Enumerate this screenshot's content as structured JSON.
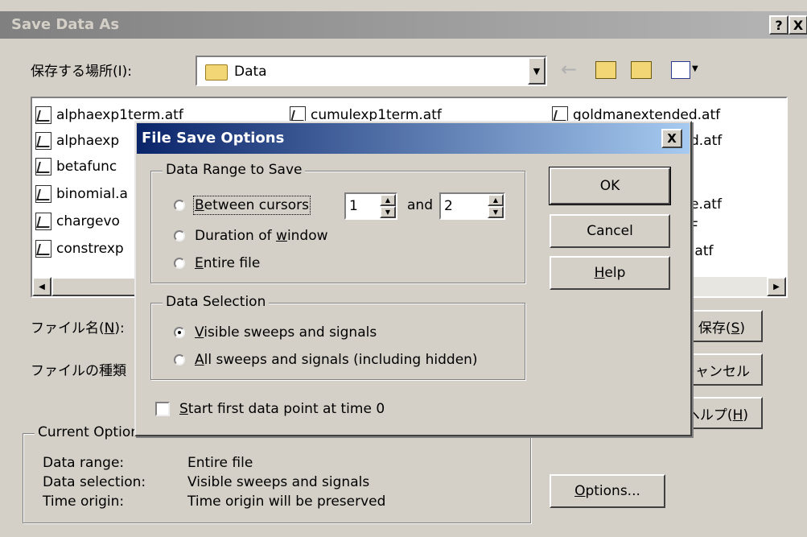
{
  "save_dialog": {
    "title": "Save Data As",
    "help_btn": "?",
    "close_btn": "X",
    "location_label": "保存する場所(I):",
    "location_value": "Data",
    "files": [
      "alphaexp1term.atf",
      "alphaexp",
      "betafunc",
      "binomial.a",
      "chargevo",
      "constrexp",
      "cumulexp1term.atf",
      "goldmanextended.atf",
      "d.atf",
      "e.atf",
      "F",
      ".atf"
    ],
    "filename_label_pre": "ファイル名(",
    "filename_label_key": "N",
    "filename_label_post": "):",
    "filetype_label": "ファイルの種類",
    "save_btn_pre": "保存(",
    "save_btn_key": "S",
    "save_btn_post": ")",
    "cancel_btn": "キャンセル",
    "help_btn_jp_pre": "ヘルプ(",
    "help_btn_jp_key": "H",
    "help_btn_jp_post": ")",
    "current_options": {
      "legend": "Current Options",
      "rows": [
        {
          "label": "Data range:",
          "value": "Entire file"
        },
        {
          "label": "Data selection:",
          "value": "Visible sweeps and signals"
        },
        {
          "label": "Time origin:",
          "value": "Time origin will be preserved"
        }
      ]
    },
    "options_btn_key": "O",
    "options_btn_rest": "ptions..."
  },
  "options_dialog": {
    "title": "File Save Options",
    "close_btn": "X",
    "range_group": "Data Range to Save",
    "between_key": "B",
    "between_rest": "etween cursors",
    "cursor_from": "1",
    "and_label": "and",
    "cursor_to": "2",
    "duration_pre": "Duration of ",
    "duration_key": "w",
    "duration_post": "indow",
    "entire_key": "E",
    "entire_rest": "ntire file",
    "selection_group": "Data Selection",
    "visible_key": "V",
    "visible_rest": "isible sweeps and signals",
    "all_key": "A",
    "all_rest": "ll sweeps and signals (including hidden)",
    "start_key": "S",
    "start_rest": "tart first data point at time 0",
    "ok_btn": "OK",
    "cancel_btn": "Cancel",
    "help_key": "H",
    "help_rest": "elp",
    "selected_range": "Entire file",
    "selected_selection": "Visible sweeps and signals",
    "start_at_zero": false
  },
  "colors": {
    "titlebar_inactive": "#808080",
    "titlebar_active": "#0a246a",
    "face": "#d4d0c8"
  }
}
